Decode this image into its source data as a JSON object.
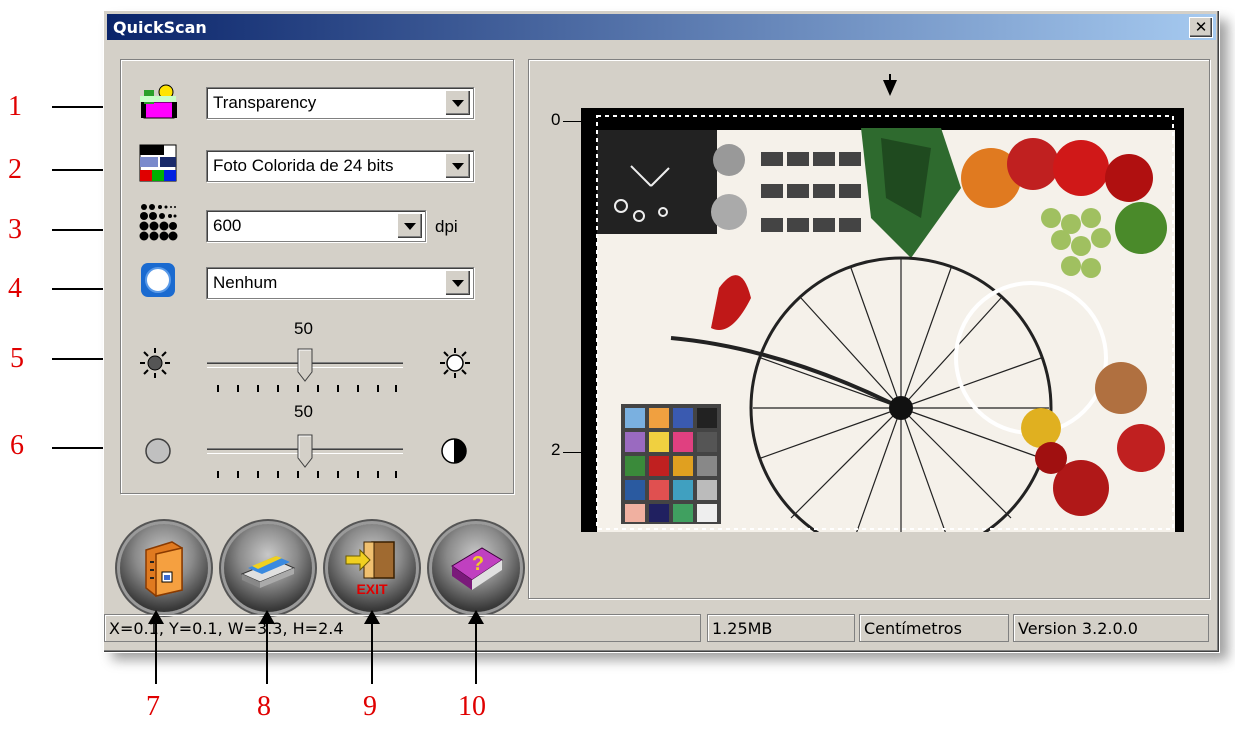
{
  "window": {
    "title": "QuickScan"
  },
  "callouts": [
    "1",
    "2",
    "3",
    "4",
    "5",
    "6",
    "7",
    "8",
    "9",
    "10"
  ],
  "settings": {
    "scan_source": {
      "value": "Transparency",
      "icon": "scan-source-icon"
    },
    "image_type": {
      "value": "Foto Colorida de 24 bits",
      "icon": "image-type-icon"
    },
    "resolution": {
      "value": "600",
      "unit": "dpi",
      "icon": "resolution-icon"
    },
    "filter": {
      "value": "Nenhum",
      "icon": "filter-icon"
    },
    "brightness": {
      "value": "50",
      "level": 0.5,
      "icon_low": "brightness-low-icon",
      "icon_high": "brightness-high-icon"
    },
    "contrast": {
      "value": "50",
      "level": 0.5,
      "icon_low": "contrast-low-icon",
      "icon_high": "contrast-high-icon"
    }
  },
  "buttons": [
    {
      "name": "scan-to-folder-button",
      "icon": "folder-icon"
    },
    {
      "name": "preview-button",
      "icon": "scanner-icon"
    },
    {
      "name": "exit-button",
      "icon": "exit-icon",
      "label": "EXIT"
    },
    {
      "name": "help-button",
      "icon": "help-book-icon",
      "label": "?"
    }
  ],
  "preview": {
    "ruler_labels": [
      "0",
      "2"
    ]
  },
  "status": {
    "coords": "X=0.1, Y=0.1, W=3.3, H=2.4",
    "size": "1.25MB",
    "units": "Centímetros",
    "version": "Version 3.2.0.0"
  },
  "colors": {
    "callout": "#e00000",
    "titlebar_start": "#0a246a",
    "titlebar_end": "#a6caf0",
    "face": "#d4d0c8"
  }
}
